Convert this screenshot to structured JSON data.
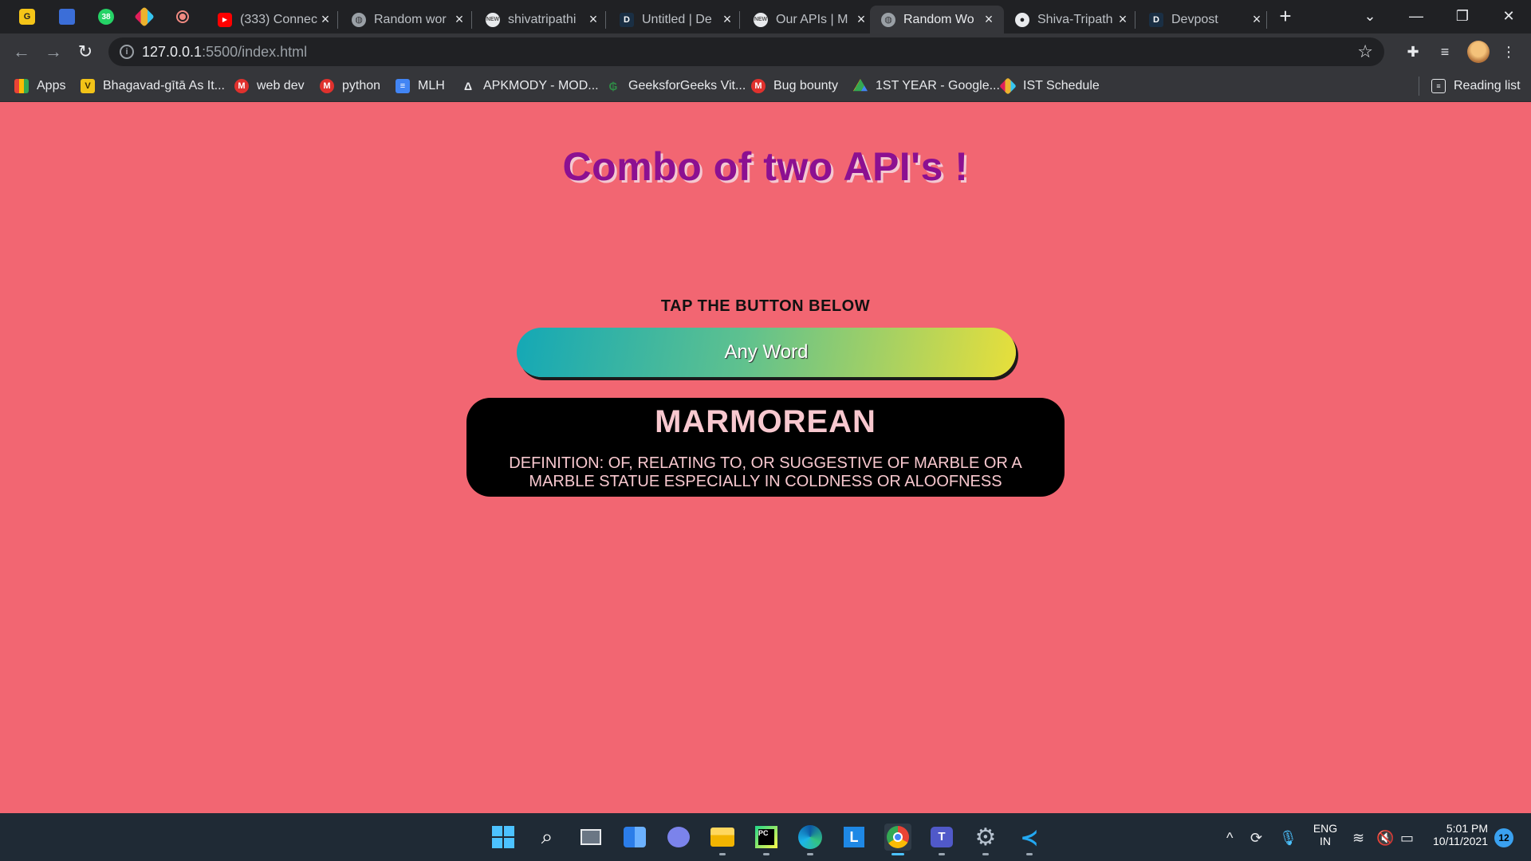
{
  "browser": {
    "tabs": [
      {
        "title": "(333) Connec",
        "favicon": "youtube-icon",
        "active": false
      },
      {
        "title": "Random wor",
        "favicon": "globe-icon",
        "active": false
      },
      {
        "title": "shivatripathi",
        "favicon": "site-icon",
        "active": false
      },
      {
        "title": "Untitled | De",
        "favicon": "devpost-icon",
        "active": false
      },
      {
        "title": "Our APIs | M",
        "favicon": "site-icon",
        "active": false
      },
      {
        "title": "Random Wo",
        "favicon": "globe-icon",
        "active": true
      },
      {
        "title": "Shiva-Tripath",
        "favicon": "github-icon",
        "active": false
      },
      {
        "title": "Devpost",
        "favicon": "devpost-icon",
        "active": false
      }
    ],
    "pinned_badge": "38",
    "url_host": "127.0.0.1",
    "url_path": ":5500/index.html",
    "bookmarks": [
      {
        "label": "Apps",
        "icon": "apps-grid-icon"
      },
      {
        "label": "Bhagavad-gītā As It...",
        "icon": "v-icon"
      },
      {
        "label": "web dev",
        "icon": "m-icon"
      },
      {
        "label": "python",
        "icon": "m-icon"
      },
      {
        "label": "MLH",
        "icon": "doc-icon"
      },
      {
        "label": "APKMODY - MOD...",
        "icon": "triangle-icon"
      },
      {
        "label": "GeeksforGeeks Vit...",
        "icon": "gfg-icon"
      },
      {
        "label": "Bug bounty",
        "icon": "m-icon"
      },
      {
        "label": "1ST YEAR - Google...",
        "icon": "drive-icon"
      },
      {
        "label": "IST Schedule",
        "icon": "slack-icon"
      }
    ],
    "reading_list": "Reading list"
  },
  "page": {
    "heading": "Combo of two API's !",
    "tap_label": "TAP THE BUTTON BELOW",
    "button_label": "Any Word",
    "word": "MARMOREAN",
    "definition": "DEFINITION: OF, RELATING TO, OR SUGGESTIVE OF MARBLE OR A MARBLE STATUE ESPECIALLY IN COLDNESS OR ALOOFNESS",
    "colors": {
      "background": "#f26672",
      "heading": "#8c1091",
      "card": "#000000",
      "card_text": "#f8c8cf"
    }
  },
  "taskbar": {
    "language_top": "ENG",
    "language_bottom": "IN",
    "time": "5:01 PM",
    "date": "10/11/2021",
    "notifications": "12"
  }
}
